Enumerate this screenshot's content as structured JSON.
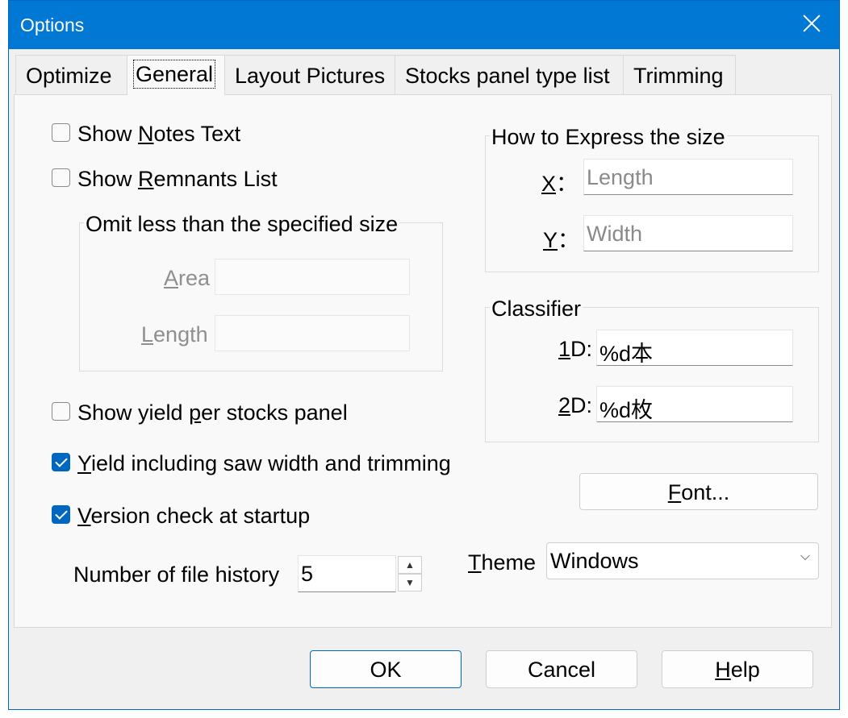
{
  "window": {
    "title": "Options"
  },
  "tabs": [
    {
      "label": "Optimize"
    },
    {
      "label": "General"
    },
    {
      "label": "Layout Pictures"
    },
    {
      "label": "Stocks panel type list"
    },
    {
      "label": "Trimming"
    }
  ],
  "active_tab": "General",
  "general": {
    "show_notes": {
      "pre": "Show ",
      "u": "N",
      "post": "otes Text",
      "checked": false
    },
    "show_remnants": {
      "pre": "Show ",
      "u": "R",
      "post": "emnants List",
      "checked": false
    },
    "omit_group": {
      "title": "Omit less than the specified size",
      "area": {
        "u": "A",
        "post": "rea",
        "value": ""
      },
      "length": {
        "u": "L",
        "post": "ength",
        "value": ""
      }
    },
    "show_yield": {
      "pre": "Show yield ",
      "u": "p",
      "post": "er stocks panel",
      "checked": false
    },
    "yield_saw": {
      "pre": "",
      "u": "Y",
      "post": "ield including saw width and trimming",
      "checked": true
    },
    "version_check": {
      "pre": "",
      "u": "V",
      "post": "ersion check at startup",
      "checked": true
    },
    "file_history": {
      "label": "Number of file history",
      "value": "5"
    },
    "size_group": {
      "title": "How to Express the size",
      "x": {
        "u": "X",
        "post": "：",
        "placeholder": "Length"
      },
      "y": {
        "u": "Y",
        "post": "：",
        "placeholder": "Width"
      }
    },
    "classifier": {
      "title": "Classifier",
      "d1": {
        "u": "1",
        "post": "D:",
        "value": "%d本"
      },
      "d2": {
        "u": "2",
        "post": "D:",
        "value": "%d枚"
      }
    },
    "font_button": {
      "u": "F",
      "post": "ont..."
    },
    "theme": {
      "u": "T",
      "post": "heme",
      "value": "Windows"
    }
  },
  "footer": {
    "ok": "OK",
    "cancel": "Cancel",
    "help": {
      "u": "H",
      "post": "elp"
    }
  }
}
